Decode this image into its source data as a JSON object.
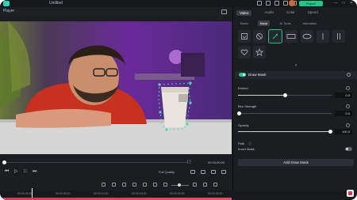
{
  "app": {
    "title": "Untitled",
    "export_label": "Export",
    "window_buttons": [
      "—",
      "□",
      "✕"
    ]
  },
  "player": {
    "label": "Player",
    "timecode": "00:00:00:00",
    "brackets": "{  }",
    "quality_label": "Full Quality",
    "playback_position": 0.0
  },
  "timeline": {
    "ruler_ticks": [
      "00:00:00:00",
      "00:00:05:00",
      "00:00:10:00",
      "00:00:15:00",
      "00:00:20:00",
      "00:00:25:00"
    ],
    "zoom_level": 0.4
  },
  "inspector": {
    "tabs": [
      {
        "label": "Video",
        "active": true
      },
      {
        "label": "Audio",
        "active": false
      },
      {
        "label": "Color",
        "active": false
      },
      {
        "label": "Speed",
        "active": false
      }
    ],
    "subtabs": [
      {
        "label": "Basic",
        "active": false
      },
      {
        "label": "Mask",
        "active": true
      },
      {
        "label": "AI Tools",
        "active": false
      },
      {
        "label": "Animation",
        "active": false
      }
    ],
    "mask_shapes": [
      {
        "icon": "image-mask-icon",
        "selected": false
      },
      {
        "icon": "no-mask-icon",
        "selected": false
      },
      {
        "icon": "draw-mask-pen-icon",
        "selected": true
      },
      {
        "icon": "rectangle-mask-icon",
        "selected": false
      },
      {
        "icon": "ellipse-mask-icon",
        "selected": false
      },
      {
        "icon": "single-line-mask-icon",
        "selected": false
      },
      {
        "icon": "double-line-mask-icon",
        "selected": false
      },
      {
        "icon": "heart-mask-icon",
        "selected": false
      },
      {
        "icon": "star-mask-icon",
        "selected": false
      }
    ],
    "draw_mask_label": "Draw Mask",
    "draw_mask_enabled": true,
    "properties": {
      "extend": {
        "label": "Extend",
        "value": "0.0",
        "position": 0.5
      },
      "blur_strength": {
        "label": "Blur Strength",
        "value": "0.0",
        "position": 0.0
      },
      "opacity": {
        "label": "Opacity",
        "value": "100.0",
        "position": 1.0
      }
    },
    "path_label": "Path",
    "invert_mask_label": "Invert Mask",
    "invert_mask_enabled": false,
    "add_button_label": "Add Draw Mask"
  },
  "colors": {
    "accent": "#22c58a",
    "panel": "#1b1d21",
    "mask_outline": "#3fe0a8"
  }
}
